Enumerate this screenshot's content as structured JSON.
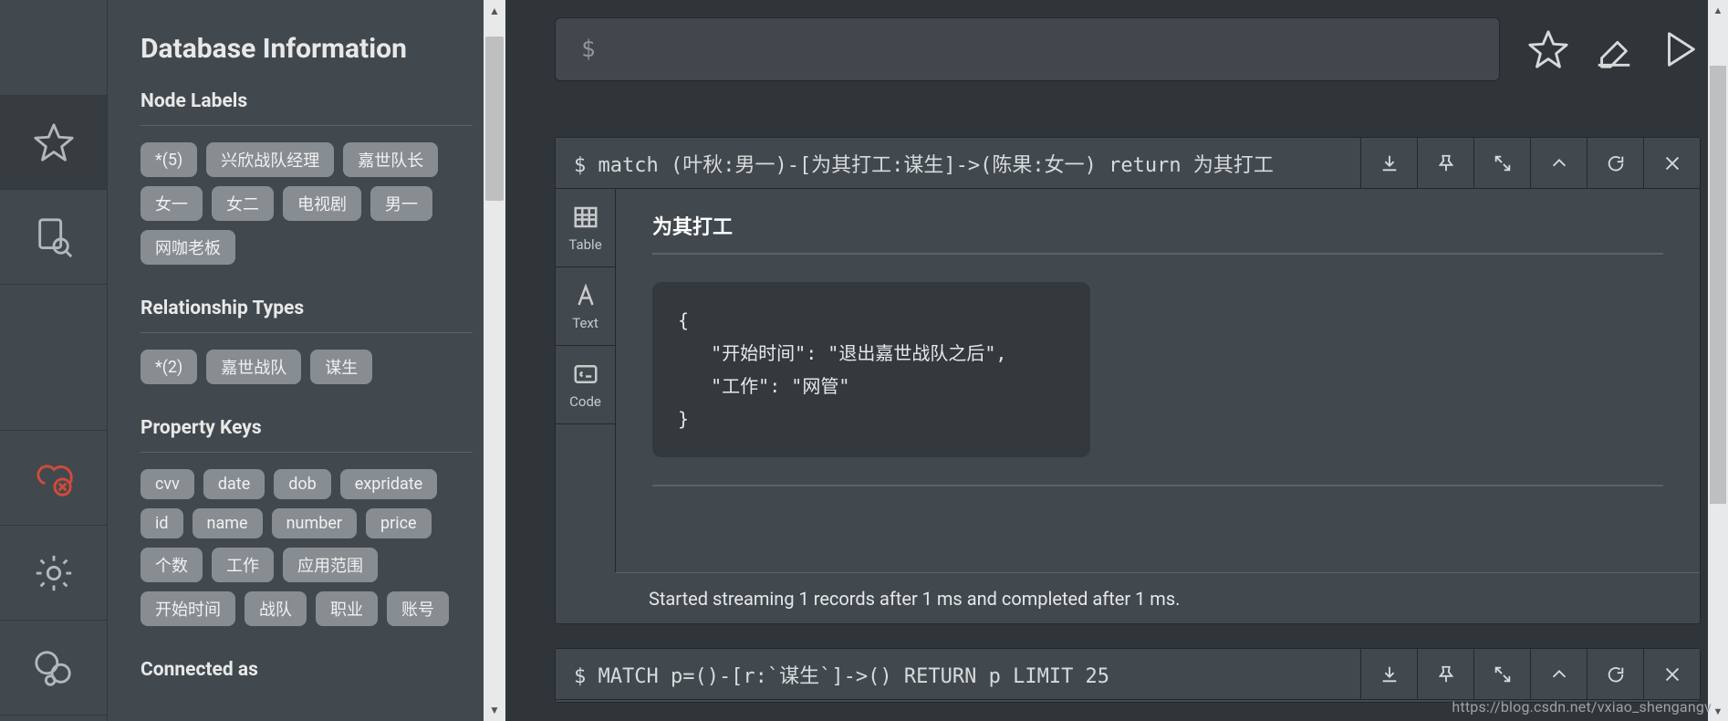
{
  "sidebar": {
    "title": "Database Information",
    "sections": {
      "nodeLabels": {
        "title": "Node Labels"
      },
      "relTypes": {
        "title": "Relationship Types"
      },
      "propKeys": {
        "title": "Property Keys"
      },
      "connected": {
        "title": "Connected as"
      }
    },
    "nodeLabels": [
      "*(5)",
      "兴欣战队经理",
      "嘉世队长",
      "女一",
      "女二",
      "电视剧",
      "男一",
      "网咖老板"
    ],
    "relTypes": [
      "*(2)",
      "嘉世战队",
      "谋生"
    ],
    "propKeys": [
      "cvv",
      "date",
      "dob",
      "expridate",
      "id",
      "name",
      "number",
      "price",
      "个数",
      "工作",
      "应用范围",
      "开始时间",
      "战队",
      "职业",
      "账号"
    ]
  },
  "editor": {
    "prompt": "$"
  },
  "frame1": {
    "query": "$ match (叶秋:男一)-[为其打工:谋生]->(陈果:女一) return 为其打工",
    "tabs": {
      "table": "Table",
      "text": "Text",
      "code": "Code"
    },
    "columnHeader": "为其打工",
    "jsonText": "{\n   \"开始时间\": \"退出嘉世战队之后\",\n   \"工作\": \"网管\"\n}",
    "footer": "Started streaming 1 records after 1 ms and completed after 1 ms."
  },
  "frame2": {
    "query": "$ MATCH p=()-[r:`谋生`]->() RETURN p LIMIT 25"
  },
  "watermark": "https://blog.csdn.net/vxiao_shengangv"
}
